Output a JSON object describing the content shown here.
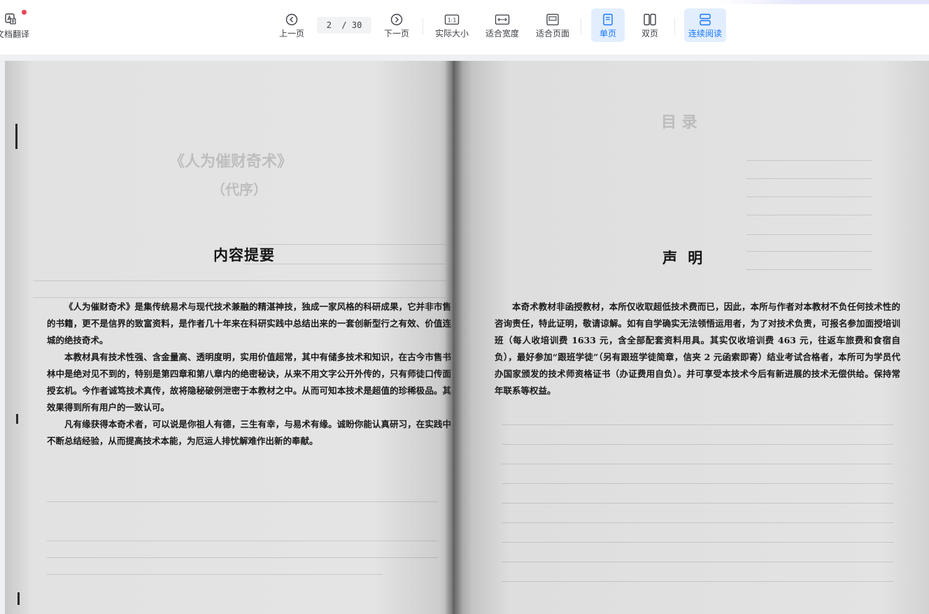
{
  "toolbar": {
    "translate_label": "文档翻译",
    "prev_label": "上一页",
    "next_label": "下一页",
    "page_current": "2",
    "page_total": "/ 30",
    "actual_size_label": "实际大小",
    "fit_width_label": "适合宽度",
    "fit_page_label": "适合页面",
    "single_page_label": "单页",
    "double_page_label": "双页",
    "continuous_label": "连续阅读",
    "actual_size_icon_text": "1:1",
    "active_color": "#1677ff",
    "active_bg": "#e2eefe",
    "notification_color": "#f0445a"
  },
  "document": {
    "left": {
      "ghost_title_1": "《人为催财奇术》",
      "ghost_title_2": "（代序）",
      "heading": "内容提要",
      "paragraphs": [
        "《人为催财奇术》是集传统易术与现代技术兼融的精湛神技，独成一家风格的科研成果，它并非市售的书籍，更不是信界的致富资料，是作者几十年来在科研实践中总结出来的一套创新型行之有效、价值连城的绝技奇术。",
        "本教材具有技术性强、含金量高、透明度明，实用价值超常，其中有储多技术和知识，在古今市售书林中是绝对见不到的，特别是第四章和第八章内的绝密秘诀，从来不用文字公开外传的，只有师徒口传面授玄机。今作者诚笃技术真传，故将隐秘破例泄密于本教材之中。从而可知本技术是超值的珍稀极品。其效果得到所有用户的一致认可。",
        "凡有缘获得本奇术者，可以说是你祖人有德，三生有幸，与易术有缘。诚盼你能认真研习，在实践中不断总结经验，从而提高技术本能，为厄运人排忧解难作出新的奉献。"
      ]
    },
    "right": {
      "ghost_title": "目  录",
      "heading": "声  明",
      "paragraphs": [
        "本奇术教材非函授教材，本所仅收取超低技术费而已，因此，本所与作者对本教材不负任何技术性的咨询责任，特此证明，敬请谅解。如有自学确实无法领悟运用者，为了对技术负责，可报名参加面授培训班（每人收培训费 1633 元，含全部配套资料用具。其实仅收培训费 463 元，往返车旅费和食宿自负），最好参加“跟班学徒”（另有跟班学徒简章，信夹 2 元函索即寄）结业考试合格者，本所可为学员代办国家颁发的技术师资格证书（办证费用自负）。并可享受本技术今后有新进展的技术无偿供给。保持常年联系等权益。"
      ]
    }
  }
}
